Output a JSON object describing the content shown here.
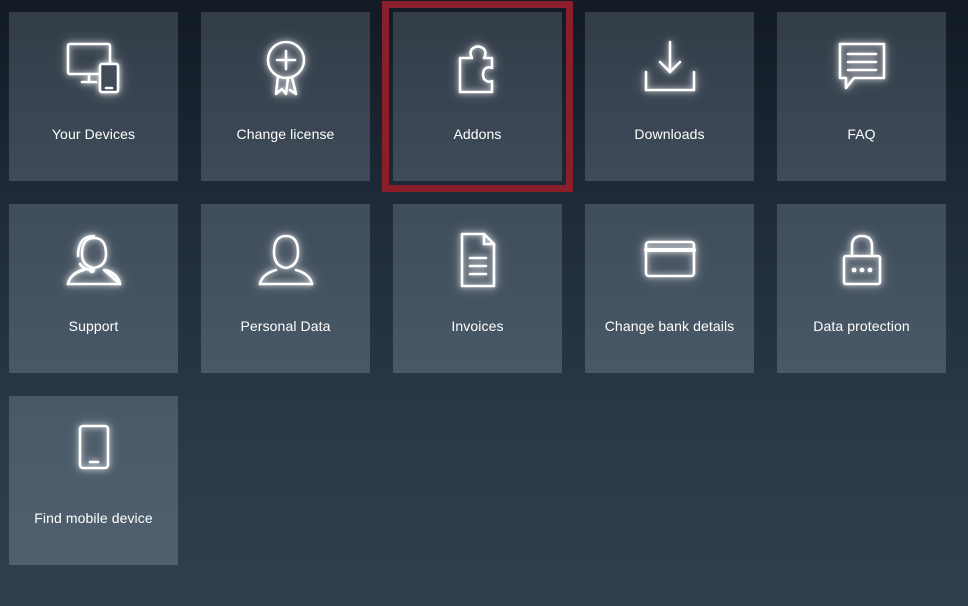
{
  "tiles": [
    {
      "label": "Your Devices",
      "icon": "devices-icon",
      "selected": false
    },
    {
      "label": "Change license",
      "icon": "license-badge-icon",
      "selected": false
    },
    {
      "label": "Addons",
      "icon": "puzzle-piece-icon",
      "selected": true
    },
    {
      "label": "Downloads",
      "icon": "download-icon",
      "selected": false
    },
    {
      "label": "FAQ",
      "icon": "chat-bubble-icon",
      "selected": false
    },
    {
      "label": "Support",
      "icon": "headset-user-icon",
      "selected": false
    },
    {
      "label": "Personal Data",
      "icon": "user-icon",
      "selected": false
    },
    {
      "label": "Invoices",
      "icon": "document-icon",
      "selected": false
    },
    {
      "label": "Change bank details",
      "icon": "credit-card-icon",
      "selected": false
    },
    {
      "label": "Data protection",
      "icon": "padlock-icon",
      "selected": false
    },
    {
      "label": "Find mobile device",
      "icon": "tablet-icon",
      "selected": false
    }
  ],
  "colors": {
    "selection_outline": "#8b1e2b",
    "tile_text": "#ffffff"
  }
}
